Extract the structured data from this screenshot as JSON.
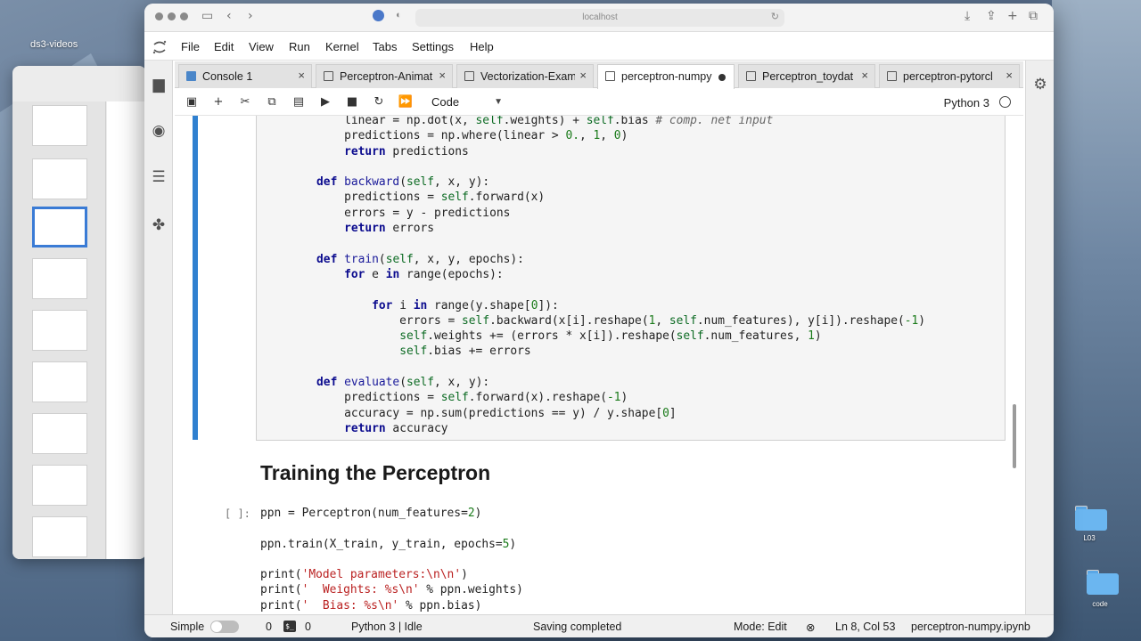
{
  "desktop": {
    "label": "ds3-videos",
    "folders": [
      {
        "label": "L03"
      },
      {
        "label": "code"
      }
    ]
  },
  "browser": {
    "url": "localhost"
  },
  "menu": [
    "File",
    "Edit",
    "View",
    "Run",
    "Kernel",
    "Tabs",
    "Settings",
    "Help"
  ],
  "tabs": [
    {
      "label": "Console 1",
      "type": "console"
    },
    {
      "label": "Perceptron-Animat",
      "type": "notebook"
    },
    {
      "label": "Vectorization-Exam",
      "type": "notebook"
    },
    {
      "label": "perceptron-numpy",
      "type": "notebook",
      "active": true
    },
    {
      "label": "Perceptron_toydat",
      "type": "notebook"
    },
    {
      "label": "perceptron-pytorcl",
      "type": "notebook"
    }
  ],
  "toolbar": {
    "cell_type": "Code",
    "kernel": "Python 3"
  },
  "heading": "Training the Perceptron",
  "cell_prompt": "[ ]:",
  "statusbar": {
    "mode_label": "Simple",
    "count_a": "0",
    "count_b": "0",
    "kernel_status": "Python 3 | Idle",
    "save_status": "Saving completed",
    "edit_mode": "Mode: Edit",
    "cursor": "Ln 8, Col 53",
    "filename": "perceptron-numpy.ipynb"
  },
  "colors": {
    "cell_marker": "#2f80d0",
    "code_bg": "#f5f5f5"
  }
}
